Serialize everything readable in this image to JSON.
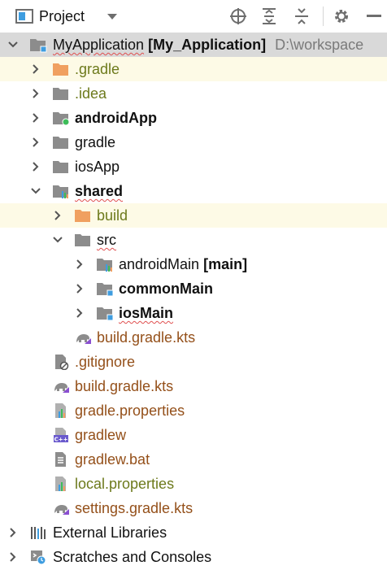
{
  "toolbar": {
    "title": "Project",
    "icons": [
      "project-view-icon",
      "dropdown-icon",
      "locate-icon",
      "expand-all-icon",
      "collapse-all-icon",
      "gear-icon",
      "hide-icon"
    ]
  },
  "tree": {
    "root": {
      "name": "MyApplication",
      "module": "[My_Application]",
      "path": "D:\\workspace"
    },
    "items": [
      {
        "label": ".gradle"
      },
      {
        "label": ".idea"
      },
      {
        "label": "androidApp"
      },
      {
        "label": "gradle"
      },
      {
        "label": "iosApp"
      },
      {
        "label": "shared"
      },
      {
        "label": "build"
      },
      {
        "label": "src"
      },
      {
        "label": "androidMain",
        "suffix": "[main]"
      },
      {
        "label": "commonMain"
      },
      {
        "label": "iosMain"
      },
      {
        "label": "build.gradle.kts"
      },
      {
        "label": ".gitignore"
      },
      {
        "label": "build.gradle.kts"
      },
      {
        "label": "gradle.properties"
      },
      {
        "label": "gradlew"
      },
      {
        "label": "gradlew.bat"
      },
      {
        "label": "local.properties"
      },
      {
        "label": "settings.gradle.kts"
      },
      {
        "label": "External Libraries"
      },
      {
        "label": "Scratches and Consoles"
      }
    ]
  },
  "colors": {
    "selection": "#d9d9d9",
    "highlight": "#fdfae6",
    "excluded_folder": "#f0a060",
    "folder": "#8c8c8c",
    "module_dot": "#3dbd5a",
    "source_badge": "#3e9de0",
    "file_brown": "#94501a",
    "file_olive": "#6d7a1c"
  }
}
